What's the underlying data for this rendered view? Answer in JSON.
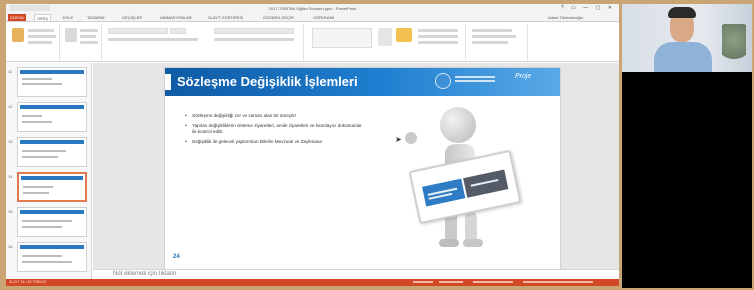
{
  "window": {
    "title": "2017-TÜBİTAK Eğitim Sunumu.pptx - PowerPoint",
    "controls": "?  ▭  —  ▢  ✕"
  },
  "ribbon_tabs": [
    "DOSYA",
    "GİRİŞ",
    "EKLE",
    "TASARIM",
    "GEÇİŞLER",
    "ANİMASYONLAR",
    "SLAYT GÖSTERİSİ",
    "GÖZDEN GEÇİR",
    "GÖRÜNÜM"
  ],
  "ribbon_user": "Adem Türkmenoğlu",
  "slide": {
    "title": "Sözleşme Değişiklik İşlemleri",
    "header_logo_text": "Proje",
    "bullets": [
      "Sözleşme değişikliği zor ve zaman alan bir süreçtir!",
      "Yapılan değişikliklerin sisteme ziyaretleri, amile ziyaretleri ve kanıtlayıcı dokümanlar ile kontrol edilir.",
      "Değişiklik ile gelecek yaptırımları Bilelim Mevzuatı ve Zaylimana"
    ],
    "page_number": "24"
  },
  "thumbnails": [
    {
      "num": "11"
    },
    {
      "num": "12"
    },
    {
      "num": "13"
    },
    {
      "num": "14"
    },
    {
      "num": "15"
    },
    {
      "num": "16"
    }
  ],
  "notes_placeholder": "Not eklemek için tıklatın",
  "status": {
    "left": "SLAYT 24 / 45   TÜRKÇE"
  },
  "colors": {
    "accent": "#d24726",
    "slide_header": "#1f7fd0",
    "page_bg": "#c9a574"
  }
}
